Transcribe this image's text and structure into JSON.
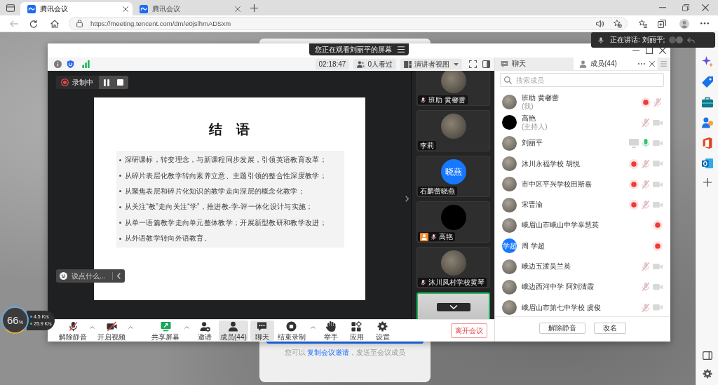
{
  "browser": {
    "tabs": [
      {
        "title": "腾讯会议",
        "selected": true
      },
      {
        "title": "腾讯会议",
        "selected": false
      }
    ],
    "back_enabled": false,
    "url": "https://meeting.tencent.com/dm/e0jslhmADSxm"
  },
  "speaking_toast": {
    "text": "正在讲话: 刘丽平;"
  },
  "page": {
    "note_before": "您可以 ",
    "link": "复制会议邀请",
    "note_after": "，发送至会议成员"
  },
  "meeting": {
    "banner": "您正在观看刘丽平的屏幕",
    "timer": "02:18:47",
    "viewers": "0人看过",
    "view_mode": "演讲者视图",
    "recording": {
      "label": "录制中"
    },
    "slide": {
      "title": "结 语",
      "bullets": [
        "深研课标，转变理念，与新课程同步发展，引领英语教育改革；",
        "从碎片表层化教学转向素养立意、主题引领的整合性深度教学；",
        "从聚焦表层和碎片化知识的教学走向深层的概念化教学；",
        "从关注“教”走向关注“学”，推进教-学-评一体化设计与实施；",
        "从单一语篇教学走向单元整体教学；开展新型教研和教学改进；",
        "从外语教学转向外语教育。"
      ]
    },
    "chat_input": {
      "placeholder": "说点什么..."
    },
    "video_tiles": [
      {
        "name": "班助 黄馨蕾",
        "avatar": {
          "kind": "photo"
        },
        "host": false,
        "mic_off": true,
        "active": false
      },
      {
        "name": "李莉",
        "avatar": {
          "kind": "photo"
        },
        "host": false,
        "mic_off": false,
        "active": false
      },
      {
        "name": "石麟蕾晓燕",
        "avatar": {
          "kind": "initials",
          "text": "晓燕"
        },
        "host": false,
        "mic_off": false,
        "active": false
      },
      {
        "name": "高艳",
        "avatar": {
          "kind": "dark"
        },
        "host": true,
        "mic_off": true,
        "active": false
      },
      {
        "name": "沐川凤村学校黄琴",
        "avatar": {
          "kind": "photo"
        },
        "host": false,
        "mic_off": true,
        "active": false
      },
      {
        "avatar": {
          "kind": "video"
        },
        "host": false,
        "mic_off": false,
        "active": true
      }
    ],
    "toolbar_left": [
      {
        "kind": "mic-off",
        "label": "解除静音",
        "menu": true,
        "selected": false
      },
      {
        "kind": "video-off",
        "label": "开启视频",
        "menu": true,
        "selected": false
      }
    ],
    "toolbar_center": [
      {
        "kind": "share-screen",
        "label": "共享屏幕",
        "menu": true,
        "selected": false
      },
      {
        "kind": "invite",
        "label": "邀请",
        "menu": false,
        "selected": false
      },
      {
        "kind": "members",
        "label": "成员(44)",
        "menu": false,
        "selected": true
      },
      {
        "kind": "chat",
        "label": "聊天",
        "menu": false,
        "selected": true
      },
      {
        "kind": "stop-record",
        "label": "结束录制",
        "menu": true,
        "selected": false
      },
      {
        "kind": "hand",
        "label": "举手",
        "menu": false,
        "selected": false
      },
      {
        "kind": "apps",
        "label": "应用",
        "menu": false,
        "selected": false
      },
      {
        "kind": "settings",
        "label": "设置",
        "menu": false,
        "selected": false
      }
    ],
    "leave_button": "离开会议"
  },
  "panel": {
    "tabs": [
      {
        "kind": "chat",
        "label": "聊天",
        "selected": false
      },
      {
        "kind": "members",
        "label": "成员(44)",
        "selected": true
      }
    ],
    "search": {
      "placeholder": "搜索成员"
    },
    "members": [
      {
        "name": "班助 黄馨蕾",
        "role": "(我)",
        "avatar": {
          "kind": "photo"
        },
        "indicators": [
          {
            "kind": "recording"
          },
          {
            "kind": "mic-off"
          }
        ]
      },
      {
        "name": "高艳",
        "role": "(主持人)",
        "avatar": {
          "kind": "dark"
        },
        "indicators": [
          {
            "kind": "mic-off"
          },
          {
            "kind": "camera-off"
          }
        ]
      },
      {
        "name": "刘丽平",
        "avatar": {
          "kind": "photo"
        },
        "indicators": [
          {
            "kind": "screen"
          },
          {
            "kind": "mic-on"
          },
          {
            "kind": "camera-off"
          }
        ]
      },
      {
        "name": "沐川永福学校 胡悦",
        "avatar": {
          "kind": "photo"
        },
        "indicators": [
          {
            "kind": "recording"
          },
          {
            "kind": "mic-off"
          },
          {
            "kind": "camera-off"
          }
        ]
      },
      {
        "name": "市中区平兴学校田斯嘉",
        "avatar": {
          "kind": "photo"
        },
        "indicators": [
          {
            "kind": "recording"
          },
          {
            "kind": "mic-off"
          },
          {
            "kind": "camera-off"
          }
        ]
      },
      {
        "name": "宋晋渝",
        "avatar": {
          "kind": "photo"
        },
        "indicators": [
          {
            "kind": "recording"
          },
          {
            "kind": "mic-off"
          },
          {
            "kind": "camera-off"
          }
        ]
      },
      {
        "name": "峨眉山市峨山中学辜慧英",
        "avatar": {
          "kind": "photo"
        },
        "indicators": [
          {
            "kind": "recording"
          }
        ]
      },
      {
        "name": "周 学超",
        "avatar": {
          "kind": "initials",
          "text": "学超"
        },
        "indicators": [
          {
            "kind": "recording"
          }
        ]
      },
      {
        "name": "峨边五渡吴兰英",
        "avatar": {
          "kind": "photo"
        },
        "indicators": [
          {
            "kind": "mic-off"
          },
          {
            "kind": "camera-off"
          }
        ]
      },
      {
        "name": "峨边西河中学 阿刘清霞",
        "avatar": {
          "kind": "photo"
        },
        "indicators": [
          {
            "kind": "mic-off"
          },
          {
            "kind": "camera-off"
          }
        ]
      },
      {
        "name": "峨眉山市第七中学校 虞俊",
        "avatar": {
          "kind": "photo"
        },
        "indicators": [
          {
            "kind": "mic-off"
          },
          {
            "kind": "camera-off"
          }
        ]
      }
    ],
    "buttons": [
      {
        "label": "解除静音"
      },
      {
        "label": "改名"
      }
    ]
  },
  "network": {
    "percent": "66$_{%}$",
    "upload": "4.5 K/s",
    "download": "25.9 K/s"
  }
}
